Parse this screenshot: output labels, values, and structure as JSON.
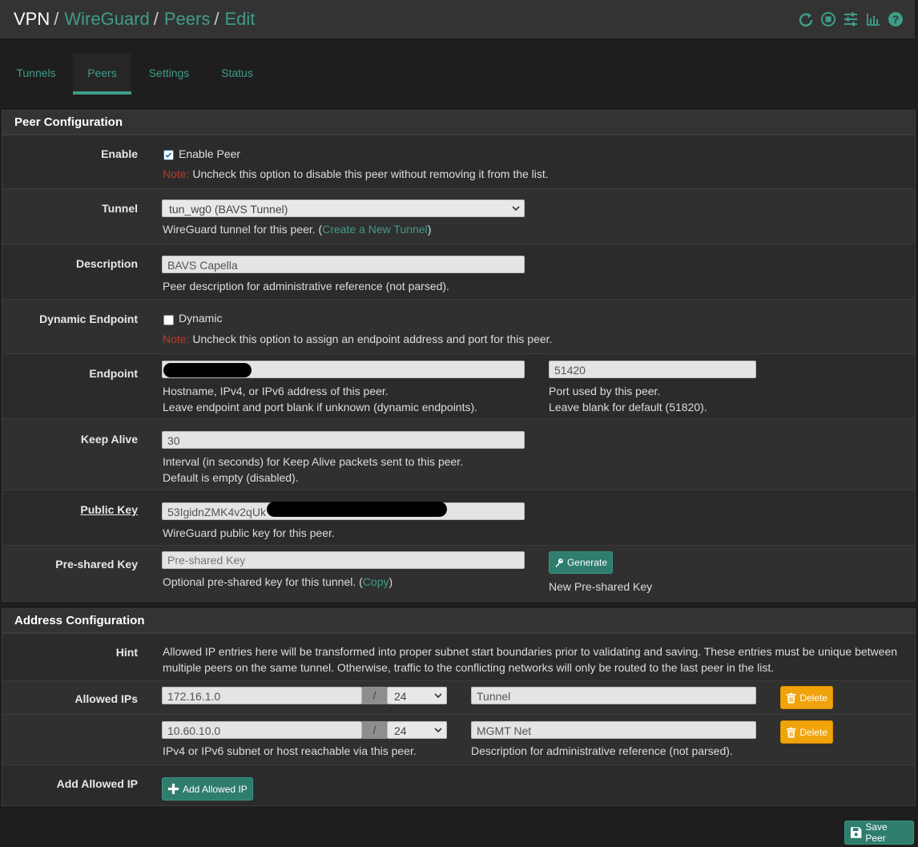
{
  "breadcrumb": {
    "first": "VPN",
    "items": [
      "WireGuard",
      "Peers",
      "Edit"
    ]
  },
  "tabs": [
    "Tunnels",
    "Peers",
    "Settings",
    "Status"
  ],
  "active_tab": "Peers",
  "peer_config": {
    "title": "Peer Configuration",
    "enable": {
      "label": "Enable",
      "checkbox_label": "Enable Peer",
      "checked": true,
      "note_label": "Note:",
      "note_text": " Uncheck this option to disable this peer without removing it from the list."
    },
    "tunnel": {
      "label": "Tunnel",
      "value": "tun_wg0 (BAVS Tunnel)",
      "help_prefix": "WireGuard tunnel for this peer. (",
      "help_link": "Create a New Tunnel",
      "help_suffix": ")"
    },
    "description": {
      "label": "Description",
      "value": "BAVS Capella",
      "help": "Peer description for administrative reference (not parsed)."
    },
    "dynamic": {
      "label": "Dynamic Endpoint",
      "checkbox_label": "Dynamic",
      "checked": false,
      "note_label": "Note:",
      "note_text": " Uncheck this option to assign an endpoint address and port for this peer."
    },
    "endpoint": {
      "label": "Endpoint",
      "value": "",
      "help1": "Hostname, IPv4, or IPv6 address of this peer.",
      "help2": "Leave endpoint and port blank if unknown (dynamic endpoints).",
      "port_value": "51420",
      "port_help1": "Port used by this peer.",
      "port_help2": "Leave blank for default (51820)."
    },
    "keepalive": {
      "label": "Keep Alive",
      "value": "30",
      "help1": "Interval (in seconds) for Keep Alive packets sent to this peer.",
      "help2": "Default is empty (disabled)."
    },
    "public_key": {
      "label": "Public Key",
      "value": "53IgidnZMK4v2qUk",
      "help": "WireGuard public key for this peer."
    },
    "psk": {
      "label": "Pre-shared Key",
      "placeholder": "Pre-shared Key",
      "help_prefix": "Optional pre-shared key for this tunnel. (",
      "help_link": "Copy",
      "help_suffix": ")",
      "generate_label": "Generate",
      "generate_help": "New Pre-shared Key"
    }
  },
  "address_config": {
    "title": "Address Configuration",
    "hint": {
      "label": "Hint",
      "line1": "Allowed IP entries here will be transformed into proper subnet start boundaries prior to validating and saving. These entries must be unique between",
      "line2": "multiple peers on the same tunnel. Otherwise, traffic to the conflicting networks will only be routed to the last peer in the list."
    },
    "allowed_label": "Allowed IPs",
    "entries": [
      {
        "ip": "172.16.1.0",
        "mask": "24",
        "desc": "Tunnel",
        "delete": "Delete"
      },
      {
        "ip": "10.60.10.0",
        "mask": "24",
        "desc": "MGMT Net",
        "delete": "Delete"
      }
    ],
    "slash": "/",
    "ip_help": "IPv4 or IPv6 subnet or host reachable via this peer.",
    "desc_help": "Description for administrative reference (not parsed).",
    "add_label": "Add Allowed IP",
    "add_button": "Add Allowed IP"
  },
  "save_button": "Save Peer",
  "colors": {
    "accent": "#3f9c8a",
    "warn": "#f0a30a",
    "note": "#c0392b",
    "panel": "#2b2b2b"
  }
}
